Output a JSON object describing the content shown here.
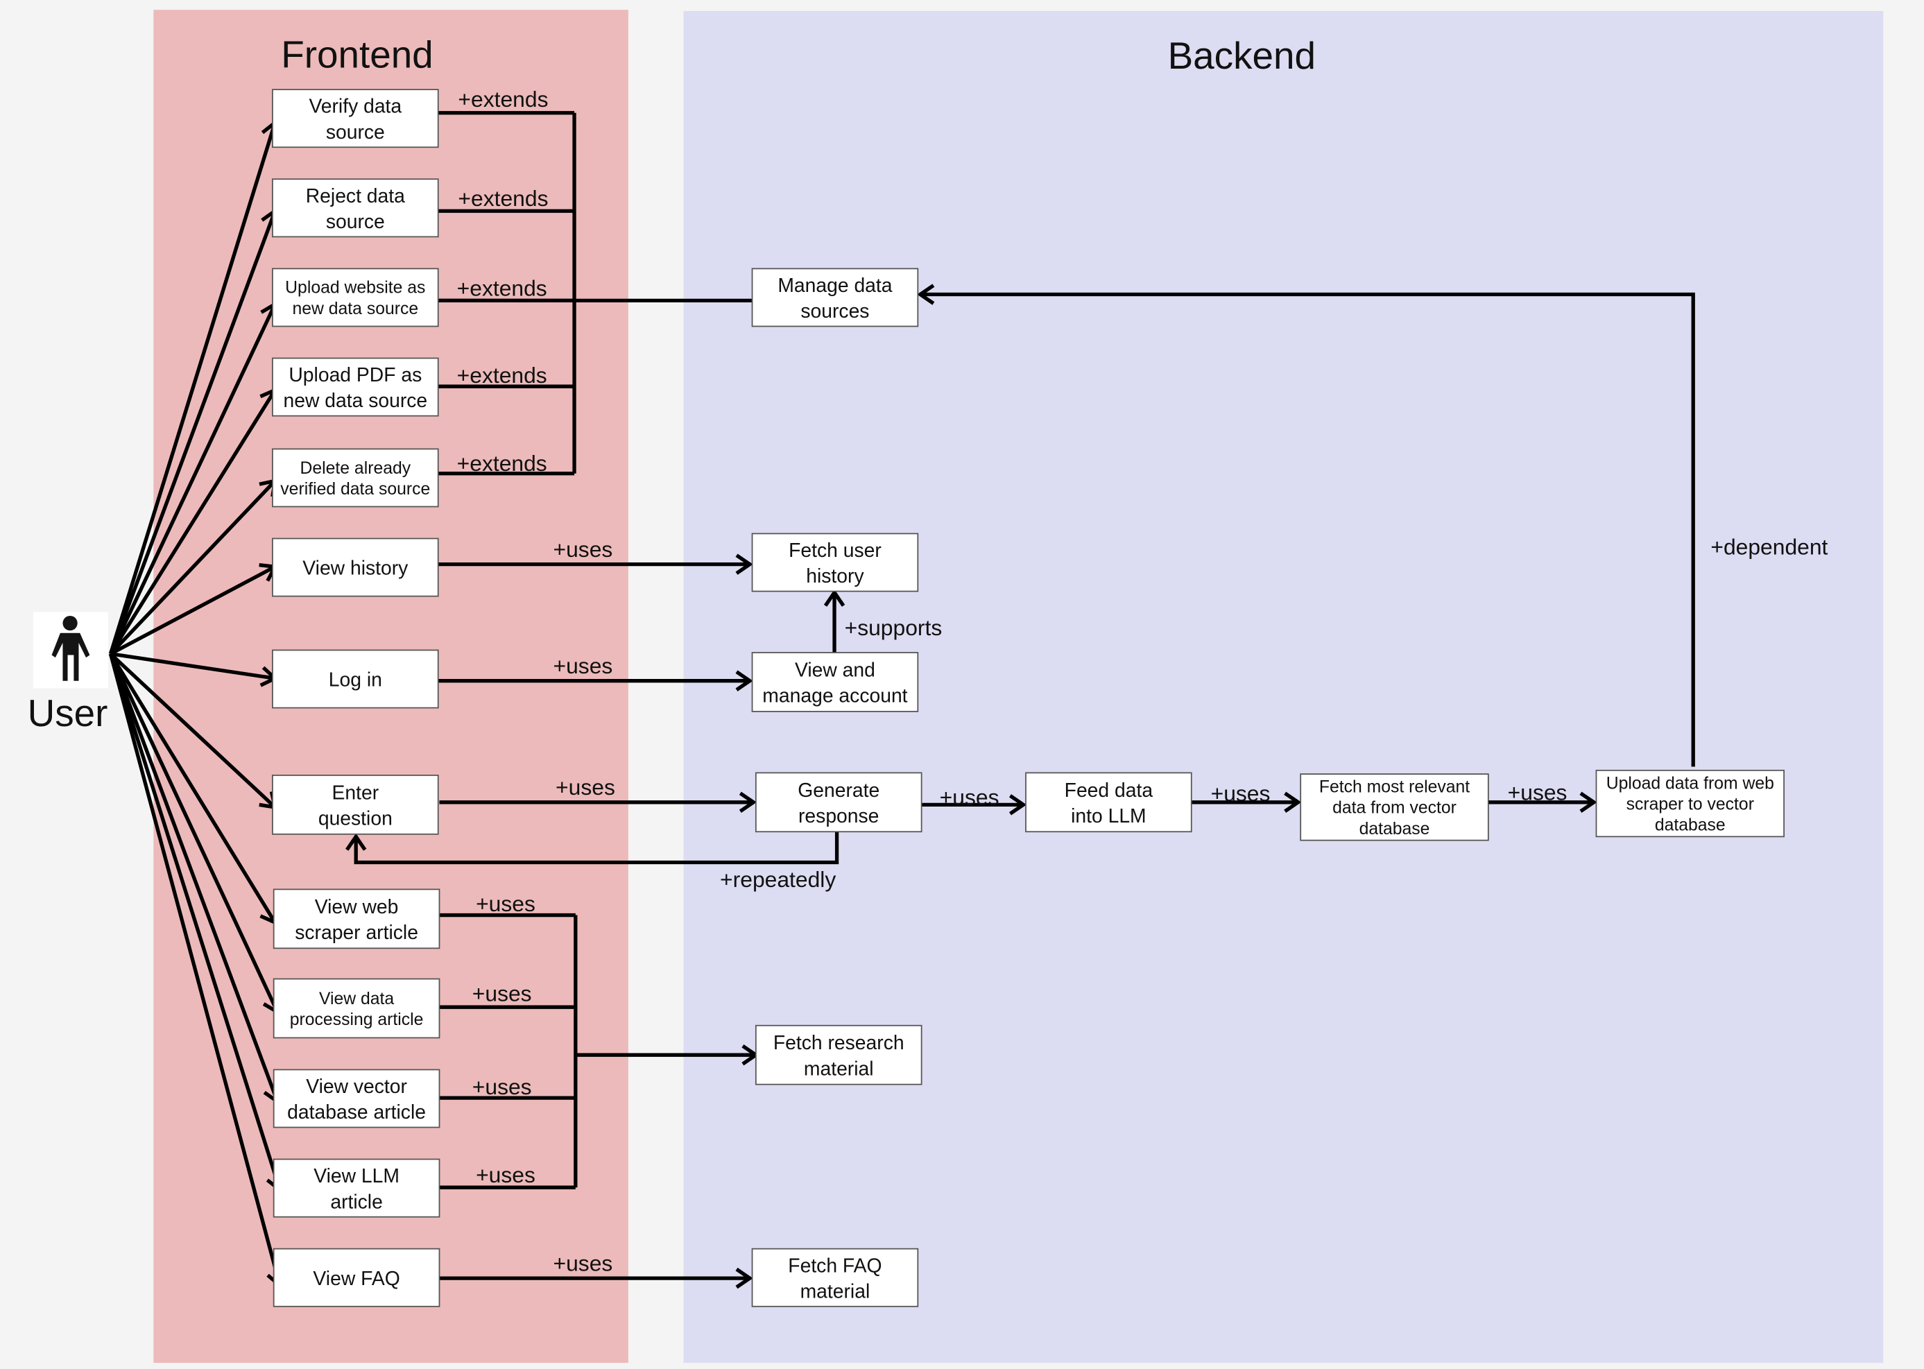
{
  "colors": {
    "background": "#f4f4f4",
    "frontend_panel": "#ecbaba",
    "backend_panel": "#dcdcf2",
    "edge": "#000000"
  },
  "actor": {
    "label": "User",
    "icon": "person-icon"
  },
  "panels": {
    "frontend": "Frontend",
    "backend": "Backend"
  },
  "frontend_use_cases": [
    {
      "id": "verify",
      "lines": [
        "Verify data",
        "source"
      ]
    },
    {
      "id": "reject",
      "lines": [
        "Reject data",
        "source"
      ]
    },
    {
      "id": "upload-website",
      "lines": [
        "Upload website as",
        "new data source"
      ]
    },
    {
      "id": "upload-pdf",
      "lines": [
        "Upload PDF as",
        "new data source"
      ]
    },
    {
      "id": "delete",
      "lines": [
        "Delete already",
        "verified data source"
      ]
    },
    {
      "id": "view-history",
      "lines": [
        "View history"
      ]
    },
    {
      "id": "log-in",
      "lines": [
        "Log in"
      ]
    },
    {
      "id": "enter-question",
      "lines": [
        "Enter",
        "question"
      ]
    },
    {
      "id": "view-web-scraper",
      "lines": [
        "View web",
        "scraper article"
      ]
    },
    {
      "id": "view-data-processing",
      "lines": [
        "View data",
        "processing article"
      ]
    },
    {
      "id": "view-vector",
      "lines": [
        "View vector",
        "database article"
      ]
    },
    {
      "id": "view-llm",
      "lines": [
        "View LLM",
        "article"
      ]
    },
    {
      "id": "view-faq",
      "lines": [
        "View FAQ"
      ]
    }
  ],
  "backend_use_cases": [
    {
      "id": "manage-data-sources",
      "lines": [
        "Manage data",
        "sources"
      ]
    },
    {
      "id": "fetch-user-history",
      "lines": [
        "Fetch user",
        "history"
      ]
    },
    {
      "id": "view-manage-account",
      "lines": [
        "View and",
        "manage account"
      ]
    },
    {
      "id": "generate-response",
      "lines": [
        "Generate",
        "response"
      ]
    },
    {
      "id": "feed-llm",
      "lines": [
        "Feed data",
        "into LLM"
      ]
    },
    {
      "id": "fetch-relevant",
      "lines": [
        "Fetch most relevant",
        "data from vector",
        "database"
      ]
    },
    {
      "id": "upload-scraper",
      "lines": [
        "Upload data from web",
        "scraper to vector",
        "database"
      ]
    },
    {
      "id": "fetch-research",
      "lines": [
        "Fetch research",
        "material"
      ]
    },
    {
      "id": "fetch-faq",
      "lines": [
        "Fetch FAQ",
        "material"
      ]
    }
  ],
  "relation_labels": {
    "extends": "+extends",
    "uses": "+uses",
    "supports": "+supports",
    "repeatedly": "+repeatedly",
    "dependent": "+dependent"
  }
}
